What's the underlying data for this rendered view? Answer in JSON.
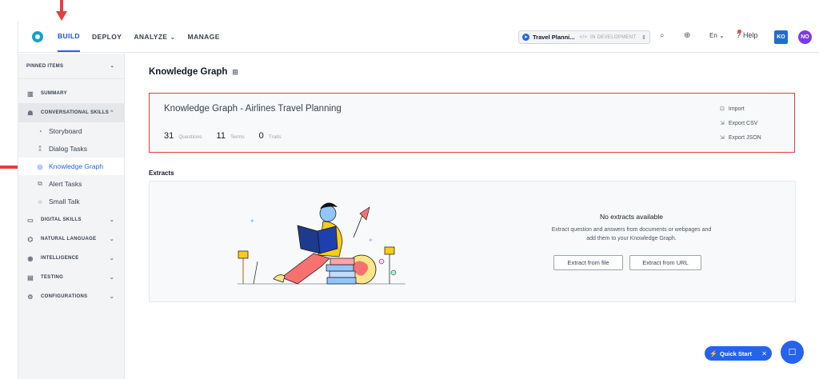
{
  "topbar": {
    "nav": [
      {
        "label": "BUILD",
        "active": true,
        "has_dropdown": false
      },
      {
        "label": "DEPLOY",
        "active": false,
        "has_dropdown": false
      },
      {
        "label": "ANALYZE",
        "active": false,
        "has_dropdown": true
      },
      {
        "label": "MANAGE",
        "active": false,
        "has_dropdown": false
      }
    ],
    "bot_name": "Travel Planni...",
    "bot_status": "IN DEVELOPMENT",
    "language": "En",
    "help_label": "Help",
    "avatar_1": "KO",
    "avatar_2": "NO"
  },
  "sidebar": {
    "pinned_label": "PINNED ITEMS",
    "summary_label": "SUMMARY",
    "conversational_label": "CONVERSATIONAL SKILLS",
    "sub_items": [
      {
        "label": "Storyboard",
        "icon": "storyboard-icon",
        "active": false
      },
      {
        "label": "Dialog Tasks",
        "icon": "dialog-icon",
        "active": false
      },
      {
        "label": "Knowledge Graph",
        "icon": "knowledge-graph-icon",
        "active": true
      },
      {
        "label": "Alert Tasks",
        "icon": "alert-icon",
        "active": false
      },
      {
        "label": "Small Talk",
        "icon": "chat-icon",
        "active": false
      }
    ],
    "sections": [
      {
        "label": "DIGITAL SKILLS",
        "icon": "monitor-icon"
      },
      {
        "label": "NATURAL LANGUAGE",
        "icon": "language-icon"
      },
      {
        "label": "INTELLIGENCE",
        "icon": "brain-icon"
      },
      {
        "label": "TESTING",
        "icon": "clipboard-icon"
      },
      {
        "label": "CONFIGURATIONS",
        "icon": "gear-icon"
      }
    ]
  },
  "main": {
    "page_title": "Knowledge Graph",
    "kg_card": {
      "title": "Knowledge Graph - Airlines Travel Planning",
      "stats": [
        {
          "value": "31",
          "label": "Questions"
        },
        {
          "value": "11",
          "label": "Terms"
        },
        {
          "value": "0",
          "label": "Traits"
        }
      ],
      "actions": [
        {
          "label": "Import",
          "icon": "import-icon"
        },
        {
          "label": "Export CSV",
          "icon": "export-icon"
        },
        {
          "label": "Export JSON",
          "icon": "export-icon"
        }
      ]
    },
    "extracts_title": "Extracts",
    "empty_title": "No extracts available",
    "empty_desc": "Extract question and answers from documents or webpages and add them to your Knowledge Graph.",
    "btn_file": "Extract from file",
    "btn_url": "Extract from URL"
  },
  "quick_start_label": "Quick Start",
  "colors": {
    "accent": "#2563eb",
    "highlight": "#e53e3e",
    "logo": "#15a3c7"
  }
}
